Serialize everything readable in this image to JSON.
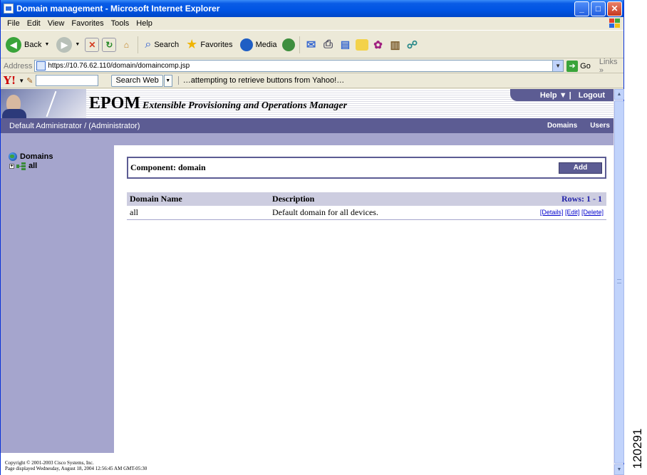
{
  "window": {
    "title": "Domain management - Microsoft Internet Explorer",
    "minimize": "_",
    "maximize": "□",
    "close": "✕"
  },
  "menu": [
    "File",
    "Edit",
    "View",
    "Favorites",
    "Tools",
    "Help"
  ],
  "toolbar": {
    "back_label": "Back",
    "search_label": "Search",
    "favorites_label": "Favorites",
    "media_label": "Media"
  },
  "address": {
    "label": "Address",
    "url": "https://10.76.62.110/domain/domaincomp.jsp",
    "go_label": "Go",
    "links_label": "Links"
  },
  "yahoo": {
    "logo": "Y!",
    "search_button": "Search Web",
    "status": "…attempting to retrieve buttons from Yahoo!…"
  },
  "epom": {
    "title": "EPOM",
    "subtitle": "Extensible Provisioning and Operations Manager",
    "help_label": "Help ▼ |",
    "logout_label": "Logout",
    "user_label": "Default Administrator / (Administrator)",
    "nav": [
      "Domains",
      "Users"
    ]
  },
  "sidebar": {
    "root_label": "Domains",
    "child_label": "all"
  },
  "component": {
    "label": "Component: domain",
    "add_label": "Add"
  },
  "table": {
    "headers": [
      "Domain Name",
      "Description"
    ],
    "rows_label": "Rows: 1 - 1",
    "rows": [
      {
        "name": "all",
        "description": "Default domain for all devices.",
        "actions": [
          "[Details]",
          "[Edit]",
          "[Delete]"
        ]
      }
    ]
  },
  "footer": {
    "copyright": "Copyright © 2001-2003 Cisco Systems, Inc.",
    "displayed": "Page displayed Wednesday, August 18, 2004 12:56:45 AM GMT-05:30"
  },
  "figure_number": "120291"
}
